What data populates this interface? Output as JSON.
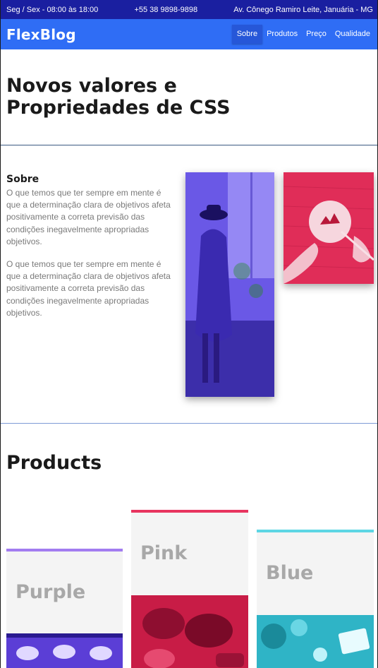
{
  "topbar": {
    "hours": "Seg / Sex - 08:00 às 18:00",
    "phone": "+55 38 9898-9898",
    "address": "Av. Cônego Ramiro Leite, Januária - MG"
  },
  "navbar": {
    "brand": "FlexBlog",
    "items": [
      "Sobre",
      "Produtos",
      "Preço",
      "Qualidade"
    ],
    "active_item": "Sobre"
  },
  "hero": {
    "title": "Novos valores e Propriedades de CSS"
  },
  "sobre": {
    "title": "Sobre",
    "paragraphs": [
      "O que temos que ter sempre em mente é que a determinação clara de objetivos afeta positivamente a correta previsão das condições inegavelmente apropriadas objetivos.",
      "O que temos que ter sempre em mente é que a determinação clara de objetivos afeta positivamente a correta previsão das condições inegavelmente apropriadas objetivos."
    ]
  },
  "products": {
    "title": "Products",
    "cards": [
      {
        "label": "Purple",
        "accent": "#a27cf0"
      },
      {
        "label": "Pink",
        "accent": "#e8345f"
      },
      {
        "label": "Blue",
        "accent": "#5dd6e4"
      }
    ]
  },
  "colors": {
    "topbar_bg": "#1a1fa0",
    "navbar_bg": "#2f6df5",
    "active_nav_bg": "#2657d8",
    "text_dark": "#1a1a1a",
    "text_muted": "#7a7a7a",
    "card_bg": "#f4f4f4"
  }
}
